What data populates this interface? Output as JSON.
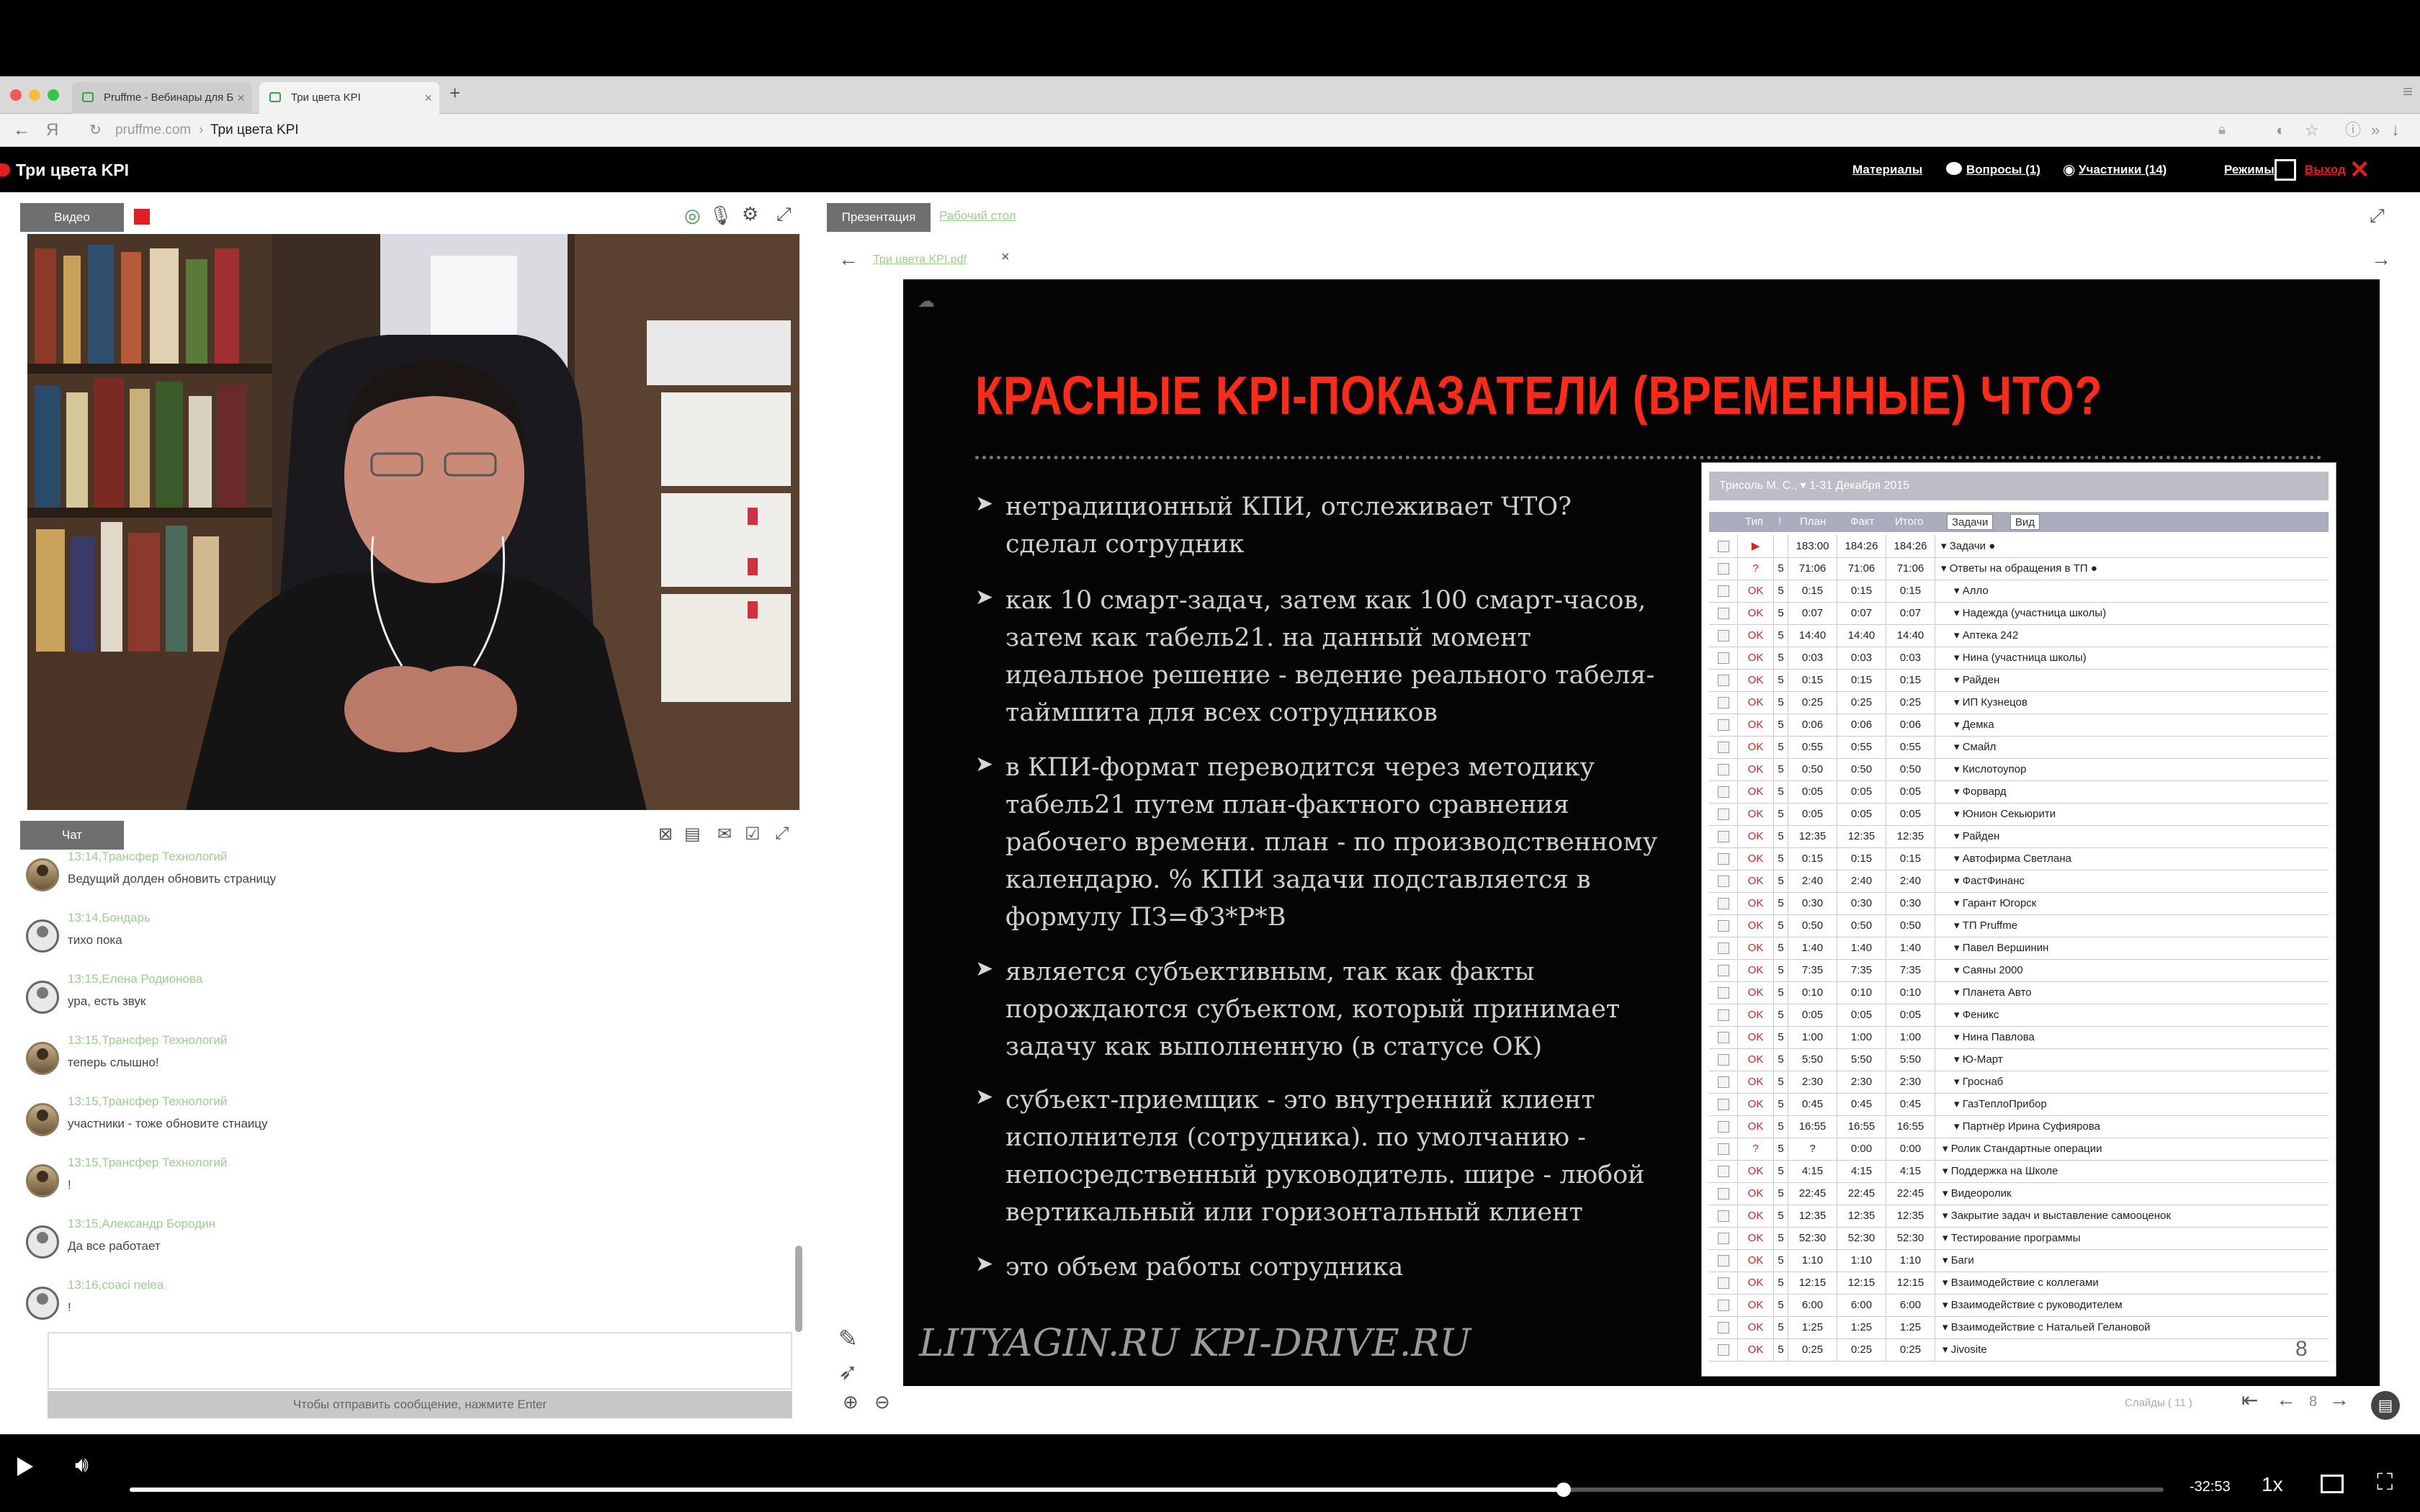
{
  "browser": {
    "tabs": [
      {
        "label": "Pruffme - Вебинары для Б"
      },
      {
        "label": "Три цвета KPI"
      }
    ],
    "url_domain": "pruffme.com",
    "url_separator": "›",
    "url_page": "Три цвета KPI"
  },
  "app": {
    "title": "Три цвета KPI",
    "nav": {
      "materials": "Материалы",
      "questions": "Вопросы (1)",
      "participants": "Участники (14)",
      "modes": "Режимы",
      "exit": "Выход"
    }
  },
  "video_panel": {
    "tab_label": "Видео"
  },
  "chat": {
    "tab_label": "Чат",
    "messages": [
      {
        "meta": "13:14,Трансфер Технологий",
        "text": "Ведущий долден обновить страницу",
        "photo": true
      },
      {
        "meta": "13:14,Бондарь",
        "text": "тихо пока",
        "photo": false
      },
      {
        "meta": "13:15,Елена Родионова",
        "text": "ура, есть звук",
        "photo": false
      },
      {
        "meta": "13:15,Трансфер Технологий",
        "text": "теперь слышно!",
        "photo": true
      },
      {
        "meta": "13:15,Трансфер Технологий",
        "text": "участники - тоже обновите стнаицу",
        "photo": true
      },
      {
        "meta": "13:15,Трансфер Технологий",
        "text": "!",
        "photo": true
      },
      {
        "meta": "13:15,Александр Бородин",
        "text": "Да все работает",
        "photo": false
      },
      {
        "meta": "13:16,coaci nelea",
        "text": "!",
        "photo": false
      }
    ],
    "send_hint": "Чтобы отправить сообщение, нажмите Enter"
  },
  "presentation": {
    "tab_presentation": "Презентация",
    "tab_desktop": "Рабочий стол",
    "file_name": "Три цвета KPI.pdf",
    "file_close": "×",
    "slides_label": "Слайды (  11  )",
    "current_slide": "8"
  },
  "slide": {
    "heading": "КРАСНЫЕ KPI-ПОКАЗАТЕЛИ (ВРЕМЕННЫЕ) ЧТО?",
    "bullets": [
      [
        "нетрадиционный КПИ, отслеживает ЧТО?",
        "сделал сотрудник"
      ],
      [
        "как 10 смарт-задач, затем как 100 смарт-часов,",
        "затем как табель21. на данный момент",
        "идеальное решение - ведение реального табеля-",
        "таймшита для всех сотрудников"
      ],
      [
        "в КПИ-формат переводится через методику",
        "табель21 путем план-фактного сравнения",
        "рабочего времени. план - по производственному",
        "календарю. % КПИ задачи подставляется в",
        "формулу ПЗ=ФЗ*Р*В"
      ],
      [
        "является субъективным, так как факты",
        "порождаются субъектом, который принимает",
        "задачу как выполненную (в статусе ОК)"
      ],
      [
        "субъект-приемщик - это внутренний клиент",
        "исполнителя (сотрудника). по умолчанию -",
        "непосредственный руководитель. шире - любой",
        "вертикальный или горизонтальный клиент"
      ],
      [
        "это объем работы сотрудника"
      ]
    ],
    "footer": "LITYAGIN.RU  KPI-DRIVE.RU",
    "page_number": "8",
    "table": {
      "caption": "Трисоль М. С.,  ▾  1-31 Декабря 2015",
      "headers": {
        "type": "Тип",
        "priority": "!",
        "plan": "План",
        "fact": "Факт",
        "total": "Итого",
        "tasks": "Задачи",
        "view": "Вид"
      },
      "rows": [
        {
          "st": "▶",
          "pr": "",
          "p": "183:00",
          "f": "184:26",
          "t": "184:26",
          "name": "Задачи ●"
        },
        {
          "st": "?",
          "pr": "5",
          "p": "71:06",
          "f": "71:06",
          "t": "71:06",
          "name": "Ответы на обращения в ТП ●"
        },
        {
          "st": "OK",
          "pr": "5",
          "p": "0:15",
          "f": "0:15",
          "t": "0:15",
          "name": "Алло"
        },
        {
          "st": "OK",
          "pr": "5",
          "p": "0:07",
          "f": "0:07",
          "t": "0:07",
          "name": "Надежда (участница школы)"
        },
        {
          "st": "OK",
          "pr": "5",
          "p": "14:40",
          "f": "14:40",
          "t": "14:40",
          "name": "Аптека 242"
        },
        {
          "st": "OK",
          "pr": "5",
          "p": "0:03",
          "f": "0:03",
          "t": "0:03",
          "name": "Нина (участница школы)"
        },
        {
          "st": "OK",
          "pr": "5",
          "p": "0:15",
          "f": "0:15",
          "t": "0:15",
          "name": "Райден"
        },
        {
          "st": "OK",
          "pr": "5",
          "p": "0:25",
          "f": "0:25",
          "t": "0:25",
          "name": "ИП Кузнецов"
        },
        {
          "st": "OK",
          "pr": "5",
          "p": "0:06",
          "f": "0:06",
          "t": "0:06",
          "name": "Демка"
        },
        {
          "st": "OK",
          "pr": "5",
          "p": "0:55",
          "f": "0:55",
          "t": "0:55",
          "name": "Смайл"
        },
        {
          "st": "OK",
          "pr": "5",
          "p": "0:50",
          "f": "0:50",
          "t": "0:50",
          "name": "Кислотоупор"
        },
        {
          "st": "OK",
          "pr": "5",
          "p": "0:05",
          "f": "0:05",
          "t": "0:05",
          "name": "Форвард"
        },
        {
          "st": "OK",
          "pr": "5",
          "p": "0:05",
          "f": "0:05",
          "t": "0:05",
          "name": "Юнион Секьюрити"
        },
        {
          "st": "OK",
          "pr": "5",
          "p": "12:35",
          "f": "12:35",
          "t": "12:35",
          "name": "Райден"
        },
        {
          "st": "OK",
          "pr": "5",
          "p": "0:15",
          "f": "0:15",
          "t": "0:15",
          "name": "Автофирма Светлана"
        },
        {
          "st": "OK",
          "pr": "5",
          "p": "2:40",
          "f": "2:40",
          "t": "2:40",
          "name": "ФастФинанс"
        },
        {
          "st": "OK",
          "pr": "5",
          "p": "0:30",
          "f": "0:30",
          "t": "0:30",
          "name": "Гарант Югорск"
        },
        {
          "st": "OK",
          "pr": "5",
          "p": "0:50",
          "f": "0:50",
          "t": "0:50",
          "name": "ТП Pruffme"
        },
        {
          "st": "OK",
          "pr": "5",
          "p": "1:40",
          "f": "1:40",
          "t": "1:40",
          "name": "Павел Вершинин"
        },
        {
          "st": "OK",
          "pr": "5",
          "p": "7:35",
          "f": "7:35",
          "t": "7:35",
          "name": "Саяны 2000"
        },
        {
          "st": "OK",
          "pr": "5",
          "p": "0:10",
          "f": "0:10",
          "t": "0:10",
          "name": "Планета Авто"
        },
        {
          "st": "OK",
          "pr": "5",
          "p": "0:05",
          "f": "0:05",
          "t": "0:05",
          "name": "Феникс"
        },
        {
          "st": "OK",
          "pr": "5",
          "p": "1:00",
          "f": "1:00",
          "t": "1:00",
          "name": "Нина Павлова"
        },
        {
          "st": "OK",
          "pr": "5",
          "p": "5:50",
          "f": "5:50",
          "t": "5:50",
          "name": "Ю-Март"
        },
        {
          "st": "OK",
          "pr": "5",
          "p": "2:30",
          "f": "2:30",
          "t": "2:30",
          "name": "Гроснаб"
        },
        {
          "st": "OK",
          "pr": "5",
          "p": "0:45",
          "f": "0:45",
          "t": "0:45",
          "name": "ГазТеплоПрибор"
        },
        {
          "st": "OK",
          "pr": "5",
          "p": "16:55",
          "f": "16:55",
          "t": "16:55",
          "name": "Партнёр Ирина Суфиярова"
        },
        {
          "st": "?",
          "pr": "5",
          "p": "?",
          "f": "0:00",
          "t": "0:00",
          "name": "Ролик Стандартные операции"
        },
        {
          "st": "OK",
          "pr": "5",
          "p": "4:15",
          "f": "4:15",
          "t": "4:15",
          "name": "Поддержка на Школе"
        },
        {
          "st": "OK",
          "pr": "5",
          "p": "22:45",
          "f": "22:45",
          "t": "22:45",
          "name": "Видеоролик"
        },
        {
          "st": "OK",
          "pr": "5",
          "p": "12:35",
          "f": "12:35",
          "t": "12:35",
          "name": "Закрытие задач и выставление самооценок"
        },
        {
          "st": "OK",
          "pr": "5",
          "p": "52:30",
          "f": "52:30",
          "t": "52:30",
          "name": "Тестирование программы"
        },
        {
          "st": "OK",
          "pr": "5",
          "p": "1:10",
          "f": "1:10",
          "t": "1:10",
          "name": "Баги"
        },
        {
          "st": "OK",
          "pr": "5",
          "p": "12:15",
          "f": "12:15",
          "t": "12:15",
          "name": "Взаимодействие с коллегами"
        },
        {
          "st": "OK",
          "pr": "5",
          "p": "6:00",
          "f": "6:00",
          "t": "6:00",
          "name": "Взаимодействие с руководителем"
        },
        {
          "st": "OK",
          "pr": "5",
          "p": "1:25",
          "f": "1:25",
          "t": "1:25",
          "name": "Взаимодействие с Натальей Гелановой"
        },
        {
          "st": "OK",
          "pr": "5",
          "p": "0:25",
          "f": "0:25",
          "t": "0:25",
          "name": "Jivosite"
        }
      ]
    }
  },
  "player": {
    "time_remaining": "-32:53",
    "speed": "1x",
    "progress": 0.705
  },
  "colors": {
    "accent_red": "#ff2a17",
    "chat_meta_green": "#9bcf8d",
    "status_red": "#e02020"
  },
  "icons": [
    "play-icon",
    "volume-icon",
    "pip-icon",
    "fullscreen-exit-icon",
    "settings-icon",
    "mic-icon",
    "camera-icon",
    "expand-icon",
    "prev-icon",
    "next-icon",
    "first-page-icon",
    "zoom-in-icon",
    "zoom-out-icon",
    "pen-icon",
    "pointer-icon"
  ]
}
